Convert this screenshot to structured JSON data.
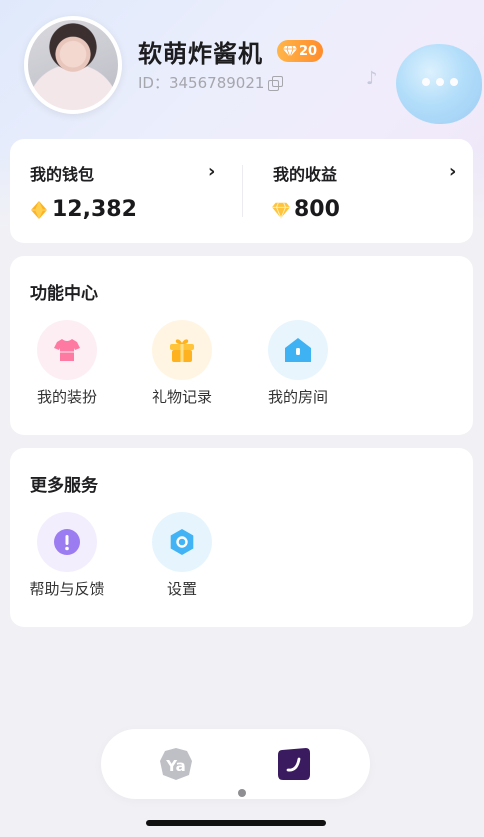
{
  "profile": {
    "username": "软萌炸酱机",
    "level": "20",
    "id_text": "ID：3456789021"
  },
  "wallet": {
    "title": "我的钱包",
    "amount": "12,382",
    "chevron": "›"
  },
  "earnings": {
    "title": "我的收益",
    "amount": "800",
    "chevron": "›"
  },
  "function_center": {
    "title": "功能中心",
    "items": [
      {
        "label": "我的装扮",
        "icon": "tshirt-icon",
        "color": "#ff7aa3"
      },
      {
        "label": "礼物记录",
        "icon": "gift-icon",
        "color": "#ffbd2e"
      },
      {
        "label": "我的房间",
        "icon": "house-icon",
        "color": "#4ab6f5"
      }
    ]
  },
  "more_services": {
    "title": "更多服务",
    "items": [
      {
        "label": "帮助与反馈",
        "icon": "help-icon",
        "color": "#9b7cf1"
      },
      {
        "label": "设置",
        "icon": "settings-icon",
        "color": "#42b3f4"
      }
    ]
  },
  "bottom_nav": {
    "home_logo": "Ya",
    "items": [
      "home-tab-icon",
      "profile-tab-icon"
    ],
    "active_index": 1
  },
  "colors": {
    "accent_orange": "#ff8c2a",
    "gem_gold": "#ffc43a",
    "nav_active": "#3b1b5f"
  }
}
